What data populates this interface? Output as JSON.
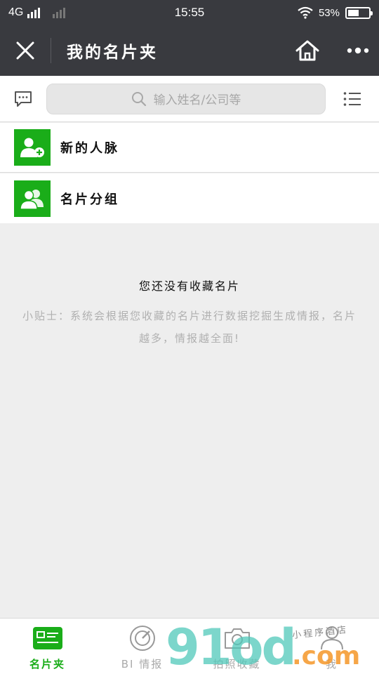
{
  "status_bar": {
    "network": "4G",
    "time": "15:55",
    "battery_text": "53%",
    "battery_level": 0.53
  },
  "header": {
    "title": "我的名片夹",
    "close_icon": "close-icon",
    "home_icon": "home-icon",
    "more_icon": "more-icon"
  },
  "search": {
    "placeholder": "输入姓名/公司等"
  },
  "entries": [
    {
      "label": "新的人脉",
      "icon": "add-contact-icon"
    },
    {
      "label": "名片分组",
      "icon": "group-icon"
    }
  ],
  "empty_state": {
    "title": "您还没有收藏名片",
    "tip": "小贴士：系统会根据您收藏的名片进行数据挖掘生成情报，名片越多，情报越全面!"
  },
  "tabs": [
    {
      "label": "名片夹",
      "icon": "card-holder-icon",
      "active": true
    },
    {
      "label": "BI 情报",
      "icon": "radar-icon",
      "active": false
    },
    {
      "label": "拍照收藏",
      "icon": "camera-icon",
      "active": false
    },
    {
      "label": "我",
      "icon": "person-icon",
      "active": false
    }
  ],
  "watermark": {
    "big": "91od",
    "com": ".com",
    "small": "小程序酒店"
  },
  "colors": {
    "accent": "#1aad19",
    "header_bg": "#393a3f",
    "page_bg": "#eeeeee"
  }
}
